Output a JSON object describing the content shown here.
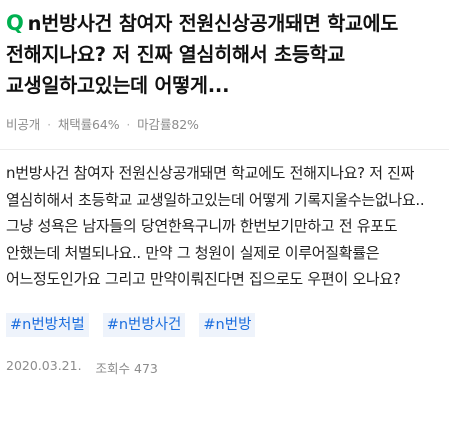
{
  "question": {
    "mark": "Q",
    "title": "n번방사건 참여자 전원신상공개돼면 학교에도 전해지나요? 저 진짜 열심히해서 초등학교 교생일하고있는데 어떻게..."
  },
  "meta": {
    "visibility": "비공개",
    "adoption_rate": "채택률64%",
    "deadline_rate": "마감률82%",
    "separator": "·"
  },
  "body": "n번방사건 참여자 전원신상공개돼면 학교에도 전해지나요? 저 진짜 열심히해서 초등학교 교생일하고있는데 어떻게 기록지울수는없나요.. 그냥 성욕은 남자들의 당연한욕구니까 한번보기만하고 전 유포도 안했는데 처벌되나요.. 만약 그 청원이 실제로 이루어질확률은 어느정도인가요 그리고 만약이뤄진다면 집으로도 우편이 오나요?",
  "tags": [
    "#n번방처벌",
    "#n번방사건",
    "#n번방"
  ],
  "footer": {
    "date": "2020.03.21.",
    "views": "조회수 473"
  },
  "colors": {
    "accent_green": "#00b050",
    "tag_blue": "#1a6dde",
    "tag_bg": "#eef3fb",
    "meta_gray": "#8c8c8c"
  }
}
